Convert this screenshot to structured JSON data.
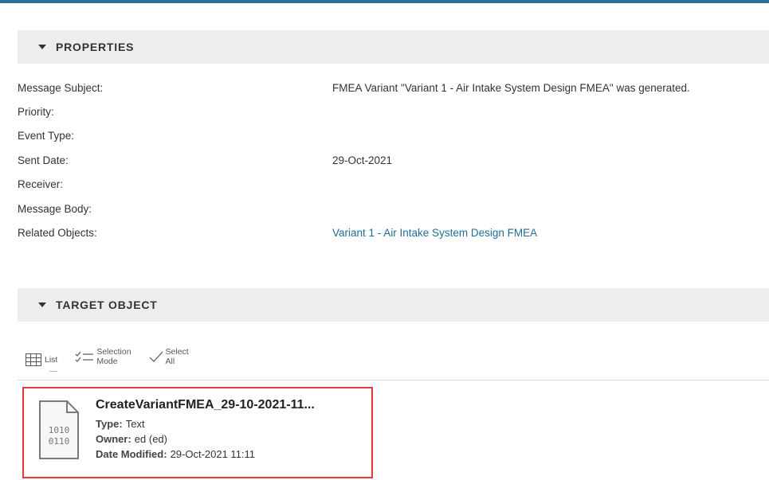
{
  "properties": {
    "header": "PROPERTIES",
    "rows": [
      {
        "label": "Message Subject:",
        "value": "FMEA Variant \"Variant 1 - Air Intake System Design FMEA\" was generated."
      },
      {
        "label": "Priority:",
        "value": ""
      },
      {
        "label": "Event Type:",
        "value": ""
      },
      {
        "label": "Sent Date:",
        "value": "29-Oct-2021"
      },
      {
        "label": "Receiver:",
        "value": ""
      },
      {
        "label": "Message Body:",
        "value": ""
      },
      {
        "label": "Related Objects:",
        "value": "Variant 1 - Air Intake System Design FMEA"
      }
    ]
  },
  "target": {
    "header": "TARGET OBJECT",
    "toolbar": {
      "list_label": "List",
      "selection_line1": "Selection",
      "selection_line2": "Mode",
      "select_line1": "Select",
      "select_line2": "All"
    },
    "tile": {
      "title": "CreateVariantFMEA_29-10-2021-11...",
      "icon_line1": "1010",
      "icon_line2": "0110",
      "type_label": "Type:",
      "type_value": "Text",
      "owner_label": "Owner:",
      "owner_value": "ed (ed)",
      "modified_label": "Date Modified:",
      "modified_value": "29-Oct-2021 11:11"
    }
  },
  "colors": {
    "accent": "#2e6e96",
    "link": "#1f6e96",
    "header_bg": "#ededed",
    "highlight_border": "#e53935"
  }
}
